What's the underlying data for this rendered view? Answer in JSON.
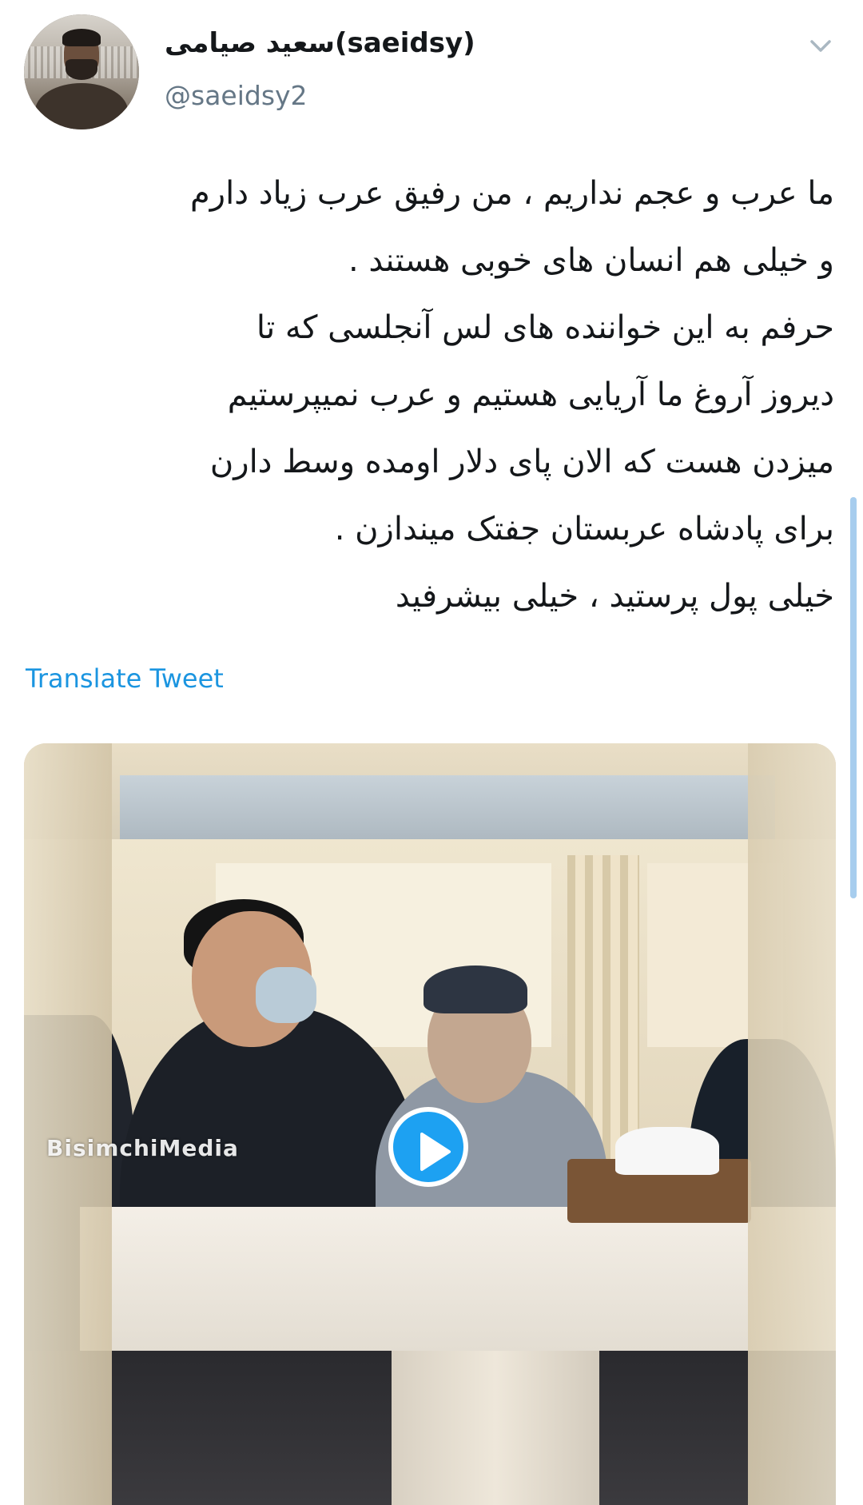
{
  "author": {
    "display_name": "سعید صیامی(saeidsy)",
    "username": "@saeidsy2"
  },
  "tweet": {
    "lines": [
      "ما عرب و عجم نداریم ، من رفیق عرب زیاد دارم",
      "و خیلی هم انسان های خوبی هستند .",
      "حرفم به این خواننده های لس آنجلسی که تا",
      "دیروز آروغ ما آریایی هستیم و عرب نمیپرستیم",
      "میزدن هست که الان پای دلار اومده وسط دارن",
      "برای پادشاه عربستان جفتک میندازن .",
      "خیلی پول پرستید ، خیلی بیشرفید"
    ],
    "translate_label": "Translate Tweet"
  },
  "media": {
    "type": "video",
    "watermark": "BisimchiMedia",
    "play_icon": "play-icon"
  },
  "icons": {
    "caret": "chevron-down-icon"
  },
  "colors": {
    "accent": "#1da1f2",
    "link": "#1b95e0",
    "text_primary": "#14171a",
    "text_secondary": "#657786"
  }
}
